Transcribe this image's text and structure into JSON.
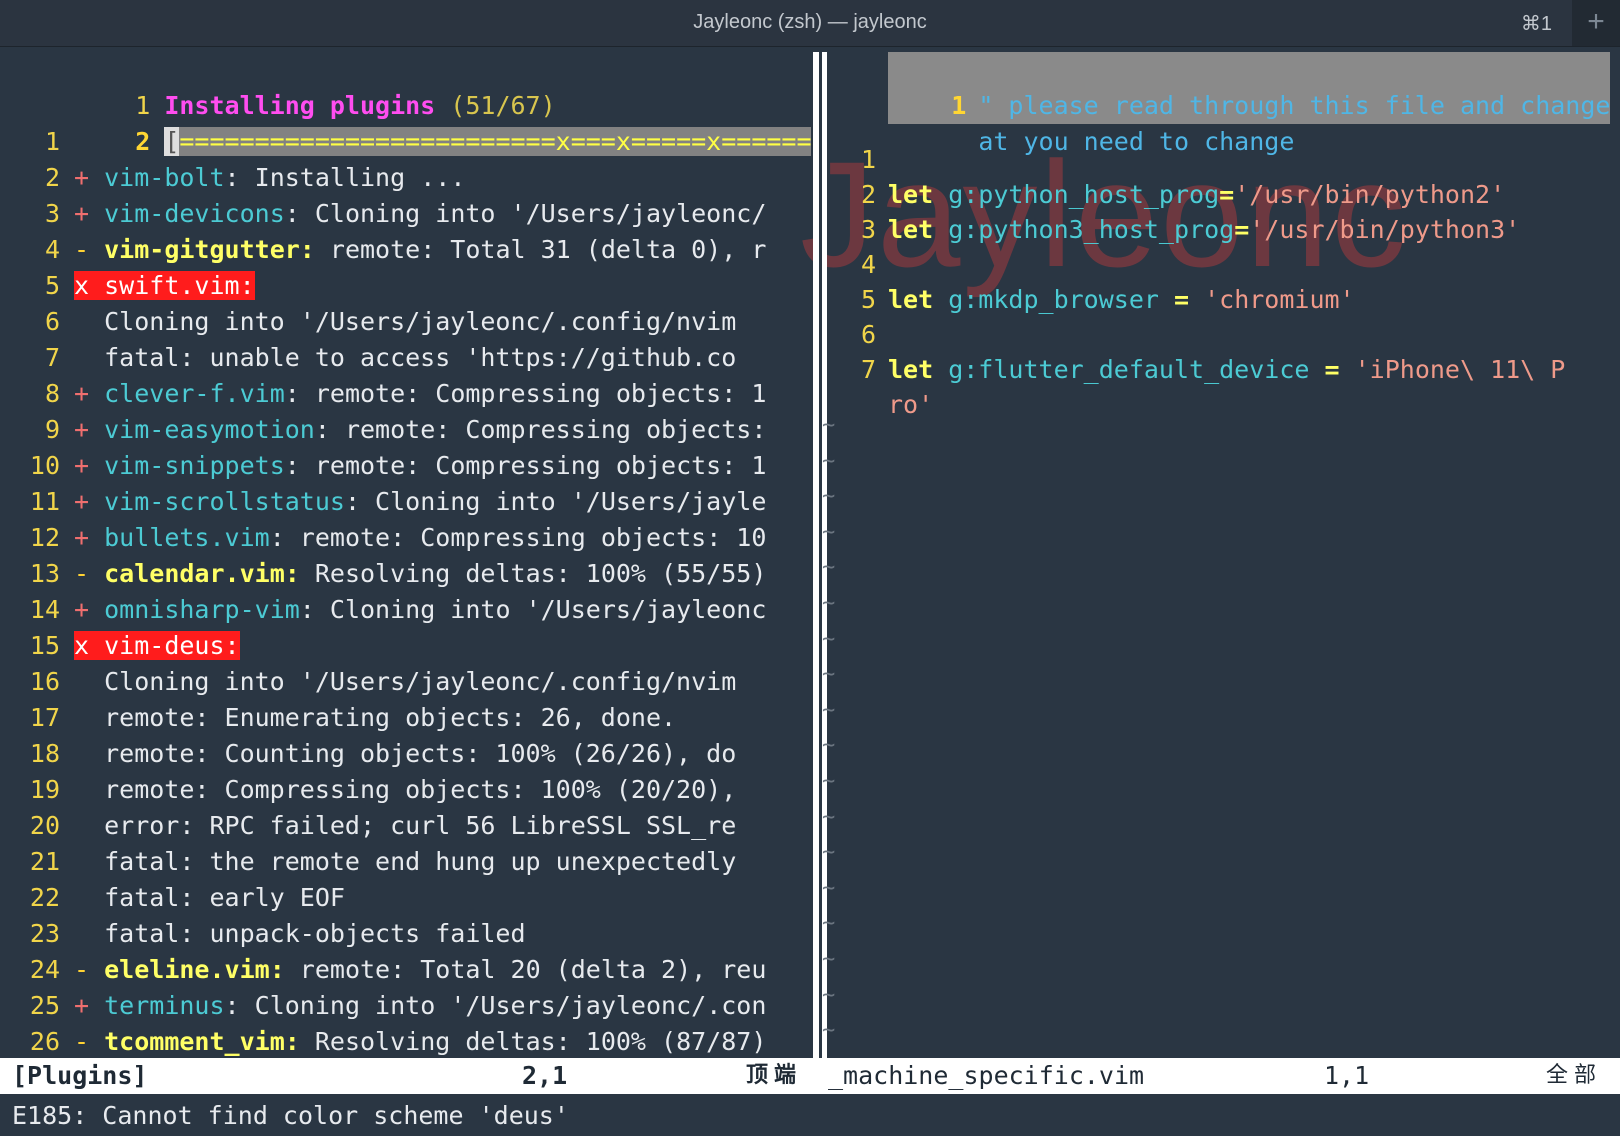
{
  "window": {
    "title": "Jayleonc (zsh) — jayleonc",
    "shortcut": "⌘1",
    "new_tab": "+"
  },
  "left": {
    "header": {
      "num": "1",
      "label": "Installing plugins",
      "count": " (51/67)"
    },
    "bar": {
      "num": "2",
      "cursor": "[",
      "text": "=========================x===x=====x======x"
    },
    "lines": [
      {
        "num": "1",
        "mark": "",
        "name": "",
        "text": ""
      },
      {
        "num": "2",
        "mark": "+",
        "name": "vim-bolt",
        "text": ": Installing ..."
      },
      {
        "num": "3",
        "mark": "+",
        "name": "vim-devicons",
        "text": ": Cloning into '/Users/jayleonc/"
      },
      {
        "num": "4",
        "mark": "-",
        "name": "vim-gitgutter:",
        "text": " remote: Total 31 (delta 0), r"
      },
      {
        "num": "5",
        "mark": "x",
        "name": "swift.vim:",
        "text": ""
      },
      {
        "num": "6",
        "mark": "",
        "name": "",
        "text": "  Cloning into '/Users/jayleonc/.config/nvim"
      },
      {
        "num": "7",
        "mark": "",
        "name": "",
        "text": "  fatal: unable to access 'https://github.co"
      },
      {
        "num": "8",
        "mark": "+",
        "name": "clever-f.vim",
        "text": ": remote: Compressing objects: 1"
      },
      {
        "num": "9",
        "mark": "+",
        "name": "vim-easymotion",
        "text": ": remote: Compressing objects:"
      },
      {
        "num": "10",
        "mark": "+",
        "name": "vim-snippets",
        "text": ": remote: Compressing objects: 1"
      },
      {
        "num": "11",
        "mark": "+",
        "name": "vim-scrollstatus",
        "text": ": Cloning into '/Users/jayle"
      },
      {
        "num": "12",
        "mark": "+",
        "name": "bullets.vim",
        "text": ": remote: Compressing objects: 10"
      },
      {
        "num": "13",
        "mark": "-",
        "name": "calendar.vim:",
        "text": " Resolving deltas: 100% (55/55)"
      },
      {
        "num": "14",
        "mark": "+",
        "name": "omnisharp-vim",
        "text": ": Cloning into '/Users/jayleonc"
      },
      {
        "num": "15",
        "mark": "x",
        "name": "vim-deus:",
        "text": ""
      },
      {
        "num": "16",
        "mark": "",
        "name": "",
        "text": "  Cloning into '/Users/jayleonc/.config/nvim"
      },
      {
        "num": "17",
        "mark": "",
        "name": "",
        "text": "  remote: Enumerating objects: 26, done."
      },
      {
        "num": "18",
        "mark": "",
        "name": "",
        "text": "  remote: Counting objects: 100% (26/26), do"
      },
      {
        "num": "19",
        "mark": "",
        "name": "",
        "text": "  remote: Compressing objects: 100% (20/20),"
      },
      {
        "num": "20",
        "mark": "",
        "name": "",
        "text": "  error: RPC failed; curl 56 LibreSSL SSL_re"
      },
      {
        "num": "21",
        "mark": "",
        "name": "",
        "text": "  fatal: the remote end hung up unexpectedly"
      },
      {
        "num": "22",
        "mark": "",
        "name": "",
        "text": "  fatal: early EOF"
      },
      {
        "num": "23",
        "mark": "",
        "name": "",
        "text": "  fatal: unpack-objects failed"
      },
      {
        "num": "24",
        "mark": "-",
        "name": "eleline.vim:",
        "text": " remote: Total 20 (delta 2), reu"
      },
      {
        "num": "25",
        "mark": "+",
        "name": "terminus",
        "text": ": Cloning into '/Users/jayleonc/.con"
      },
      {
        "num": "26",
        "mark": "-",
        "name": "tcomment_vim:",
        "text": " Resolving deltas: 100% (87/87)"
      }
    ]
  },
  "right": {
    "comment": {
      "num": "1",
      "line1": "\" please read through this file and change wh",
      "line2": "at you need to change"
    },
    "lines": [
      {
        "num": "1",
        "kw": "",
        "var": "",
        "op": "",
        "str": ""
      },
      {
        "num": "2",
        "kw": "let",
        "var": " g:python_host_prog",
        "op": "=",
        "str": "'/usr/bin/python2'"
      },
      {
        "num": "3",
        "kw": "let",
        "var": " g:python3_host_prog",
        "op": "=",
        "str": "'/usr/bin/python3'"
      },
      {
        "num": "4",
        "kw": "",
        "var": "",
        "op": "",
        "str": ""
      },
      {
        "num": "5",
        "kw": "let",
        "var": " g:mkdp_browser ",
        "op": "=",
        "str": " 'chromium'"
      },
      {
        "num": "6",
        "kw": "",
        "var": "",
        "op": "",
        "str": ""
      },
      {
        "num": "7",
        "kw": "let",
        "var": " g:flutter_default_device ",
        "op": "=",
        "str": " 'iPhone\\ 11\\ P"
      }
    ],
    "wrap": "ro'",
    "tilde": "~"
  },
  "watermark": "Jayleonc",
  "status": {
    "left_name": "[Plugins]",
    "left_pos": "2,1",
    "left_scroll": "顶端",
    "right_name": "_machine_specific.vim",
    "right_pos": "1,1",
    "right_scroll": "全部"
  },
  "cmdline": "E185: Cannot find color scheme 'deus'"
}
